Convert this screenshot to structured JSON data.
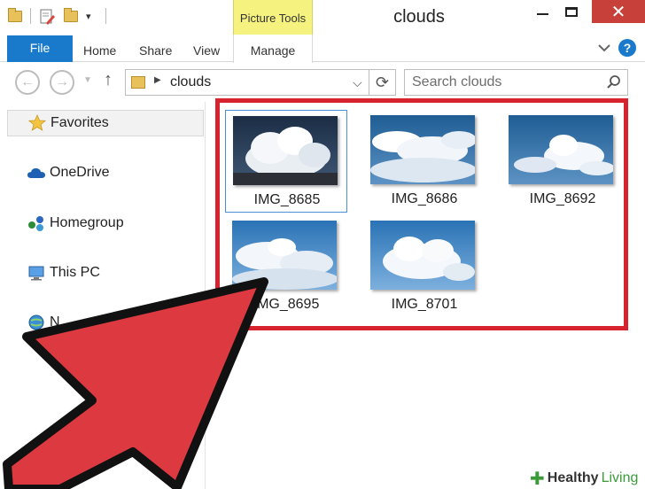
{
  "window": {
    "title": "clouds",
    "contextual_group": "Picture Tools",
    "close_glyph": "✕"
  },
  "ribbon": {
    "tabs": [
      {
        "label": "File"
      },
      {
        "label": "Home"
      },
      {
        "label": "Share"
      },
      {
        "label": "View"
      },
      {
        "label": "Manage"
      }
    ],
    "help_glyph": "?"
  },
  "address": {
    "path": "clouds",
    "search_placeholder": "Search clouds"
  },
  "navigation": {
    "items": [
      {
        "label": "Favorites",
        "icon": "star-icon"
      },
      {
        "label": "OneDrive",
        "icon": "cloud-icon"
      },
      {
        "label": "Homegroup",
        "icon": "homegroup-icon"
      },
      {
        "label": "This PC",
        "icon": "computer-icon"
      },
      {
        "label": "N",
        "icon": "network-icon"
      }
    ]
  },
  "files": [
    {
      "name": "IMG_8685",
      "selected": true
    },
    {
      "name": "IMG_8686",
      "selected": false
    },
    {
      "name": "IMG_8692",
      "selected": false
    },
    {
      "name": "IMG_8695",
      "selected": false
    },
    {
      "name": "IMG_8701",
      "selected": false
    }
  ],
  "annotation": {
    "highlight_color": "#d6232d",
    "arrow_color": "#dc3a40"
  },
  "watermark": {
    "part1": "Healthy",
    "part2": "Living"
  },
  "colors": {
    "file_tab": "#1979ca",
    "contextual_tab": "#f6f27f",
    "close_button": "#c7413a",
    "selection_border": "#4b8fd6"
  }
}
